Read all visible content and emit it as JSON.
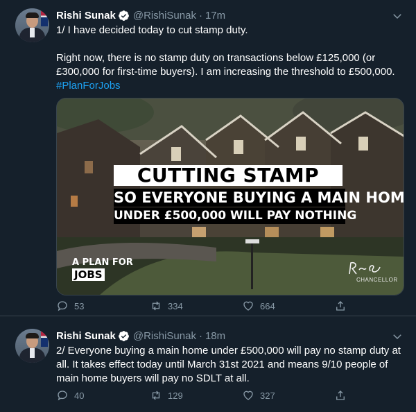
{
  "colors": {
    "background": "#15202b",
    "text": "#ffffff",
    "muted": "#8899a6",
    "link": "#1da1f2",
    "divider": "#38444d"
  },
  "tweets": [
    {
      "author": {
        "name": "Rishi Sunak",
        "handle": "@RishiSunak",
        "time": "17m",
        "avatar_icon": "profile-photo"
      },
      "text": {
        "line1": "1/ I have decided today to cut stamp duty.",
        "line2": "Right now, there is no stamp duty on transactions below £125,000 (or £300,000 for first-time buyers). I am increasing the threshold to £500,000.",
        "hashtag": "#PlanForJobs"
      },
      "media": {
        "headline": "CUTTING STAMP DUTY",
        "sub1": "SO EVERYONE BUYING A MAIN HOME",
        "sub2": "UNDER £500,000 WILL PAY NOTHING",
        "plan_line1": "A PLAN FOR",
        "plan_line2": "JOBS",
        "signature_role": "CHANCELLOR"
      },
      "stats": {
        "replies": "53",
        "retweets": "334",
        "likes": "664"
      }
    },
    {
      "author": {
        "name": "Rishi Sunak",
        "handle": "@RishiSunak",
        "time": "18m",
        "avatar_icon": "profile-photo"
      },
      "text": {
        "line1": "2/ Everyone buying a main home under £500,000 will pay no stamp duty at all. It takes effect today until March 31st 2021 and means 9/10 people of main home buyers will pay no SDLT at all."
      },
      "stats": {
        "replies": "40",
        "retweets": "129",
        "likes": "327"
      }
    }
  ],
  "separator": "·",
  "icons": [
    "verified-badge-icon",
    "chevron-down-icon",
    "reply-icon",
    "retweet-icon",
    "like-icon",
    "share-icon"
  ]
}
